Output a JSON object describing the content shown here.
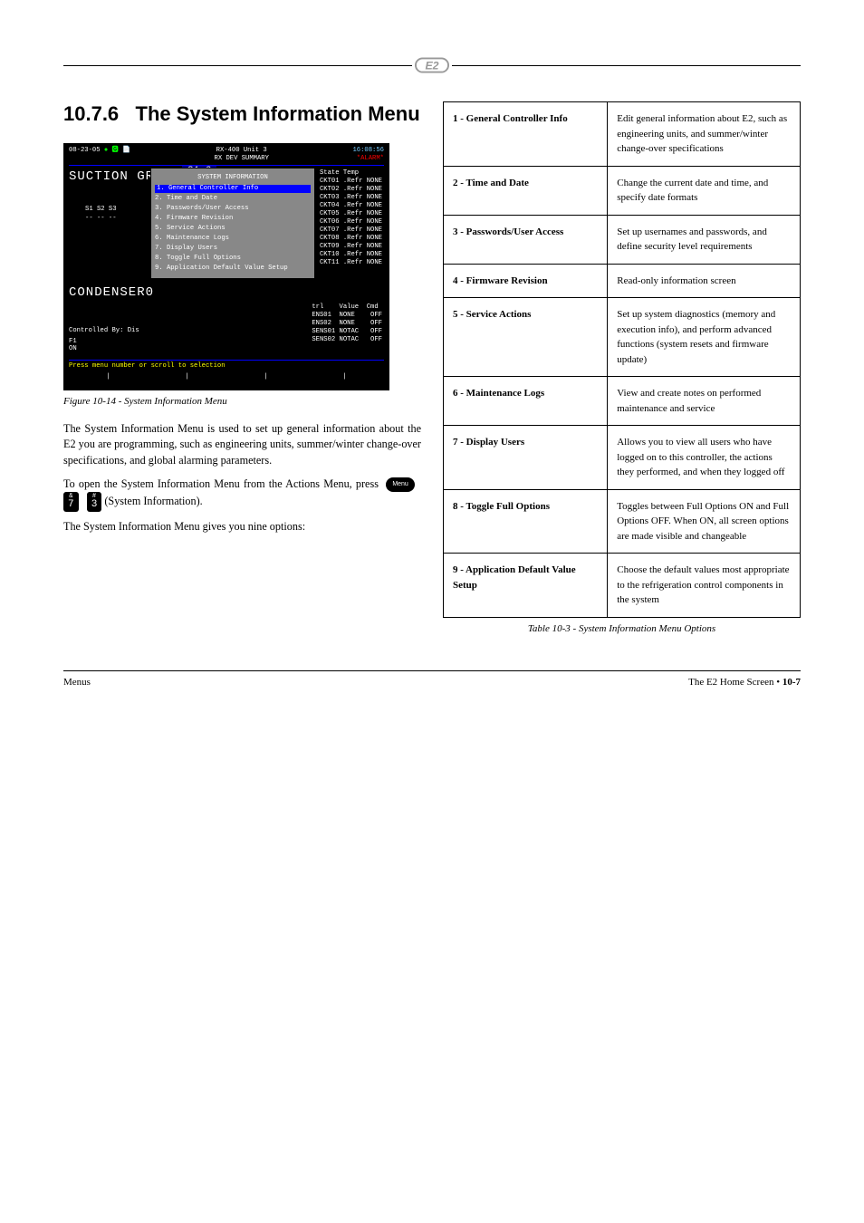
{
  "section": {
    "number": "10.7.6",
    "title": "The System Information Menu"
  },
  "screenshot": {
    "header": {
      "date": "08-23-05",
      "icons": "● 🅶 📄",
      "center_line1": "RX-400 Unit 3",
      "center_line2": "RX DEV SUMMARY",
      "time": "16:08:56",
      "alarm": "*ALARM*"
    },
    "suction_label": "SUCTION GRP01",
    "popup_tab": "21.6",
    "s_headers": "S1   S2   S3",
    "s_dashes": "--   --   --",
    "condenser_label": "CONDENSER0",
    "controlled_by": "Controlled By: Dis",
    "f1_label": "F1",
    "on_label": "ON",
    "popup": {
      "title": "SYSTEM INFORMATION",
      "items": [
        {
          "num": "1.",
          "label": "General Controller Info",
          "selected": true
        },
        {
          "num": "2.",
          "label": "Time and Date"
        },
        {
          "num": "3.",
          "label": "Passwords/User Access"
        },
        {
          "num": "4.",
          "label": "Firmware Revision"
        },
        {
          "num": "5.",
          "label": "Service Actions"
        },
        {
          "num": "6.",
          "label": "Maintenance Logs"
        },
        {
          "num": "7.",
          "label": "Display Users"
        },
        {
          "num": "8.",
          "label": "Toggle Full Options"
        },
        {
          "num": "9.",
          "label": "Application Default Value Setup"
        }
      ]
    },
    "state_header": "State Temp",
    "state_rows": [
      "CKT01 .Refr NONE",
      "CKT02 .Refr NONE",
      "CKT03 .Refr NONE",
      "CKT04 .Refr NONE",
      "CKT05 .Refr NONE",
      "CKT06 .Refr NONE",
      "CKT07 .Refr NONE",
      "CKT08 .Refr NONE",
      "CKT09 .Refr NONE",
      "CKT10 .Refr NONE",
      "CKT11 .Refr NONE"
    ],
    "bottom_table_header": "trl    Value  Cmd",
    "bottom_table_rows": [
      "ENS01  NONE    OFF",
      "ENS02  NONE    OFF",
      "SENS01 NOTAC   OFF",
      "SENS02 NOTAC   OFF"
    ],
    "footer_hint": "Press menu number or scroll to selection"
  },
  "fig_caption_label": "Figure 10-14",
  "fig_caption_text": " - System Information Menu",
  "body_para1": "The System Information Menu is used to set up general information about the E2 you are programming, such as engineering units, summer/winter change-over specifications, and global alarming parameters.",
  "body_para2_prefix": "To open the System Information Menu from the Actions Menu, press ",
  "body_para2_key_menu": "Menu",
  "body_para2_key7_sup": "&",
  "body_para2_key7_main": "7",
  "body_para2_key3_sup": "#",
  "body_para2_key3_main": "3",
  "body_para2_suffix": " (System Information).",
  "body_para3": "The System Information Menu gives you nine options:",
  "table": {
    "rows": [
      {
        "opt": "1 - General Controller Info",
        "desc": "Edit general information about E2, such as engineering units, and summer/winter change-over specifications"
      },
      {
        "opt": "2 - Time and Date",
        "desc": "Change the current date and time, and specify date formats"
      },
      {
        "opt": "3 - Passwords/User Access",
        "desc": "Set up usernames and passwords, and define security level requirements"
      },
      {
        "opt": "4 - Firmware Revision",
        "desc": "Read-only information screen"
      },
      {
        "opt": "5 - Service Actions",
        "desc": "Set up system diagnostics (memory and execution info), and perform advanced functions (system resets and firmware update)"
      },
      {
        "opt": "6 - Maintenance Logs",
        "desc": "View and create notes on performed maintenance and service"
      },
      {
        "opt": "7 - Display Users",
        "desc": "Allows you to view all users who have logged on to this controller, the actions they performed, and when they logged off"
      },
      {
        "opt": "8 - Toggle Full Options",
        "desc": "Toggles between Full Options ON and Full Options OFF. When ON, all screen options are made visible and changeable"
      },
      {
        "opt": "9 - Application Default Value Setup",
        "desc": "Choose the default values most appropriate to the refrigeration control components in the system"
      }
    ]
  },
  "table_caption_label": "Table 10-3",
  "table_caption_text": " - System Information Menu Options",
  "footer": {
    "left": "Menus",
    "right_prefix": "The E2 Home Screen • ",
    "right_page": "10-7"
  }
}
